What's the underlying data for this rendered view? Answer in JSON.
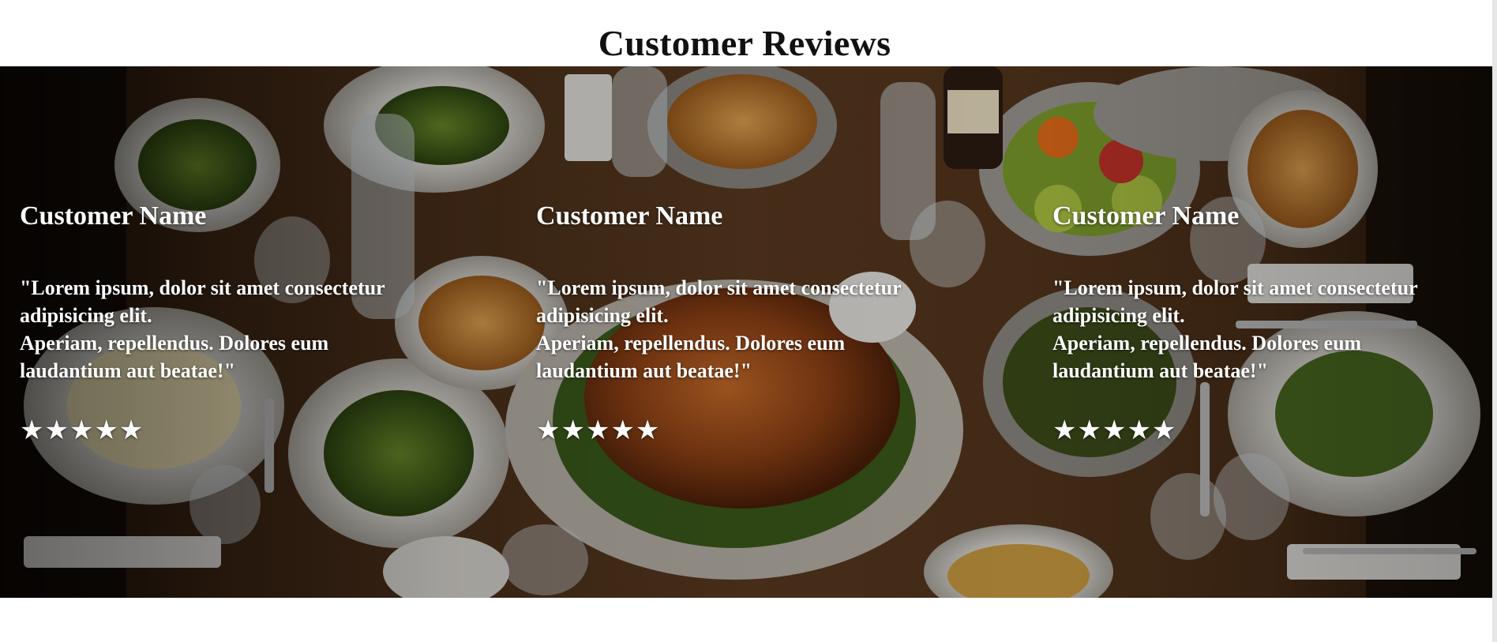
{
  "section": {
    "title": "Customer Reviews"
  },
  "banner": {
    "image": "thanksgiving-table-photo"
  },
  "reviews": [
    {
      "name": "Customer Name",
      "quote_line1": "\"Lorem ipsum, dolor sit amet consectetur adipisicing elit.",
      "quote_line2": "Aperiam, repellendus. Dolores eum laudantium aut beatae!\"",
      "stars": "★★★★★",
      "rating": 5
    },
    {
      "name": "Customer Name",
      "quote_line1": "\"Lorem ipsum, dolor sit amet consectetur adipisicing elit.",
      "quote_line2": "Aperiam, repellendus. Dolores eum laudantium aut beatae!\"",
      "stars": "★★★★★",
      "rating": 5
    },
    {
      "name": "Customer Name",
      "quote_line1": "\"Lorem ipsum, dolor sit amet consectetur adipisicing elit.",
      "quote_line2": "Aperiam, repellendus. Dolores eum laudantium aut beatae!\"",
      "stars": "★★★★★",
      "rating": 5
    }
  ],
  "colors": {
    "text_on_image": "#ffffff",
    "title": "#111111",
    "table_wood": "#4a2e1a"
  }
}
